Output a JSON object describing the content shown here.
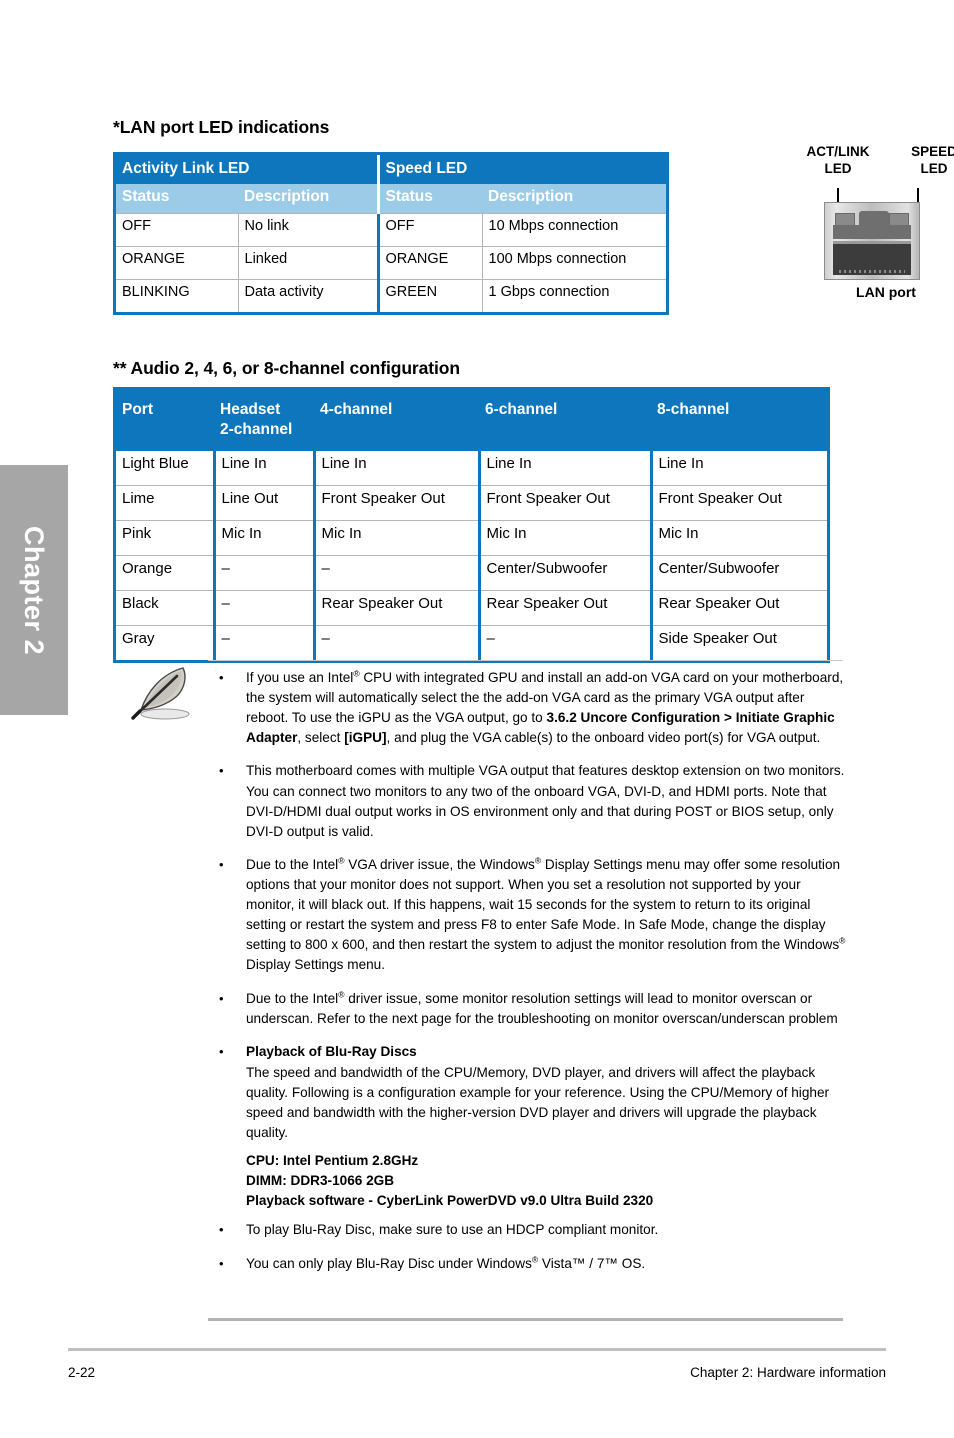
{
  "chapter_tab": {
    "label": "Chapter 2"
  },
  "lan_section": {
    "title": "*LAN port LED indications",
    "table": {
      "group_headers": [
        "Activity Link LED",
        "Speed LED"
      ],
      "sub_headers": [
        "Status",
        "Description",
        "Status",
        "Description"
      ],
      "rows": [
        [
          "OFF",
          "No link",
          "OFF",
          "10 Mbps connection"
        ],
        [
          "ORANGE",
          "Linked",
          "ORANGE",
          "100 Mbps connection"
        ],
        [
          "BLINKING",
          "Data activity",
          "GREEN",
          "1 Gbps connection"
        ]
      ]
    },
    "diagram": {
      "left_label_line1": "ACT/LINK",
      "left_label_line2": "LED",
      "right_label_line1": "SPEED",
      "right_label_line2": "LED",
      "caption": "LAN port"
    }
  },
  "audio_section": {
    "title": "** Audio 2, 4, 6, or 8-channel configuration",
    "table": {
      "headers": [
        "Port",
        "Headset\n2-channel",
        "4-channel",
        "6-channel",
        "8-channel"
      ],
      "header_port": "Port",
      "header_headset_line1": "Headset",
      "header_headset_line2": "2-channel",
      "header_4ch": "4-channel",
      "header_6ch": "6-channel",
      "header_8ch": "8-channel",
      "rows": [
        [
          "Light Blue",
          "Line In",
          "Line In",
          "Line In",
          "Line In"
        ],
        [
          "Lime",
          "Line Out",
          "Front Speaker Out",
          "Front Speaker Out",
          "Front Speaker Out"
        ],
        [
          "Pink",
          "Mic In",
          "Mic In",
          "Mic In",
          "Mic In"
        ],
        [
          "Orange",
          "–",
          "–",
          "Center/Subwoofer",
          "Center/Subwoofer"
        ],
        [
          "Black",
          "–",
          "Rear Speaker Out",
          "Rear Speaker Out",
          "Rear Speaker Out"
        ],
        [
          "Gray",
          "–",
          "–",
          "–",
          "Side Speaker Out"
        ]
      ]
    }
  },
  "notes": {
    "bullet_glyph": "•",
    "items": [
      {
        "id": "note-igpu",
        "html": "If you use an Intel<sup>®</sup> CPU with integrated GPU and install an add-on VGA card on your motherboard, the system will automatically select the the add-on VGA card as the primary VGA output after reboot. To use the iGPU as the VGA output, go to <b>3.6.2 Uncore Configuration &gt; Initiate Graphic Adapter</b>, select <b>[iGPU]</b>, and plug the VGA cable(s) to the onboard video port(s) for VGA output."
      },
      {
        "id": "note-multi-vga",
        "html": "This motherboard comes with multiple VGA output that features desktop extension on two monitors. You can connect two monitors to any two of the onboard VGA, DVI-D, and HDMI ports. Note that DVI-D/HDMI dual output works in OS environment only and that during POST or BIOS setup, only DVI-D output is valid."
      },
      {
        "id": "note-vga-driver",
        "html": "Due to the Intel<sup>®</sup> VGA driver issue, the Windows<sup>®</sup> Display Settings menu may offer some resolution options that your monitor does not support. When you set a resolution not supported by your monitor, it will black out. If this happens, wait 15 seconds for the system to return to its original setting or restart the system and press F8 to enter Safe Mode. In Safe Mode, change the display setting to 800 x 600, and then restart the system to adjust the monitor resolution from the Windows<sup>®</sup> Display Settings menu."
      },
      {
        "id": "note-overscan",
        "html": "Due to the Intel<sup>®</sup> driver issue, some monitor resolution settings will lead to monitor overscan or underscan. Refer to the next page for the troubleshooting on monitor overscan/underscan problem"
      },
      {
        "id": "note-bluray",
        "html": "<span class=\"note-sub-title\">Playback of Blu-Ray Discs</span>The speed and bandwidth of the CPU/Memory, DVD player, and drivers will affect the playback quality. Following is a configuration example for your reference. Using the CPU/Memory of higher speed and bandwidth with the higher-version DVD player and drivers will upgrade the playback quality."
      }
    ],
    "spec_lines": [
      "CPU: Intel Pentium 2.8GHz",
      "DIMM: DDR3-1066 2GB",
      "Playback software - CyberLink PowerDVD v9.0 Ultra Build 2320"
    ],
    "trailing_items": [
      {
        "id": "note-hdcp",
        "html": "To play Blu-Ray Disc, make sure to use an HDCP compliant monitor."
      },
      {
        "id": "note-os",
        "html": "You can only play Blu-Ray Disc under Windows<sup>®</sup> Vista™ / 7™ OS."
      }
    ]
  },
  "footer": {
    "page_number": "2-22",
    "chapter_label": "Chapter 2: Hardware information"
  },
  "colors": {
    "header_blue": "#0d76bc",
    "subheader_blue": "#9ccbe8",
    "tab_gray": "#a6a6a6",
    "rule_gray": "#c0c0c0"
  }
}
